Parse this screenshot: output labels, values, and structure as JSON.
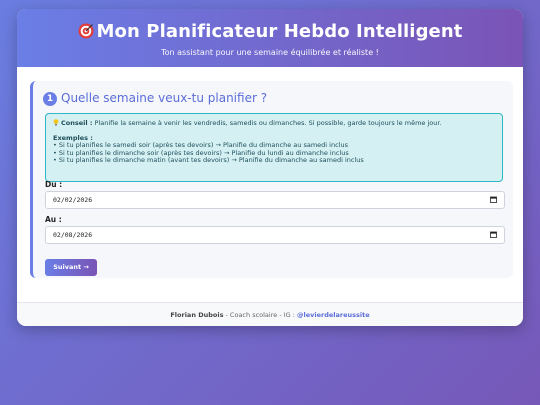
{
  "header": {
    "title": "Mon Planificateur Hebdo Intelligent",
    "subtitle": "Ton assistant pour une semaine équilibrée et réaliste !"
  },
  "step": {
    "number": "1",
    "title": "Quelle semaine veux-tu planifier ?"
  },
  "tip": {
    "label": "Conseil :",
    "text": "Planifie la semaine à venir les vendredis, samedis ou dimanches. Si possible, garde toujours le même jour.",
    "examples_title": "Exemples :",
    "examples": [
      "• Si tu planifies le samedi soir (après tes devoirs) → Planifie du dimanche au samedi inclus",
      "• Si tu planifies le dimanche soir (après tes devoirs) → Planifie du lundi au dimanche inclus",
      "• Si tu planifies le dimanche matin (avant tes devoirs) → Planifie du dimanche au samedi inclus"
    ]
  },
  "form": {
    "from_label": "Du :",
    "from_value": "02/02/2026",
    "to_label": "Au :",
    "to_value": "02/08/2026",
    "next_label": "Suivant →"
  },
  "footer": {
    "name": "Florian Dubois",
    "middle": " - Coach scolaire - IG : ",
    "handle": "@levierdelareussite"
  },
  "colors": {
    "accent": "#6b7ee6",
    "accent_dark": "#7a54b6",
    "tip_bg": "#d4f0f3",
    "tip_border": "#2fb8c2"
  }
}
